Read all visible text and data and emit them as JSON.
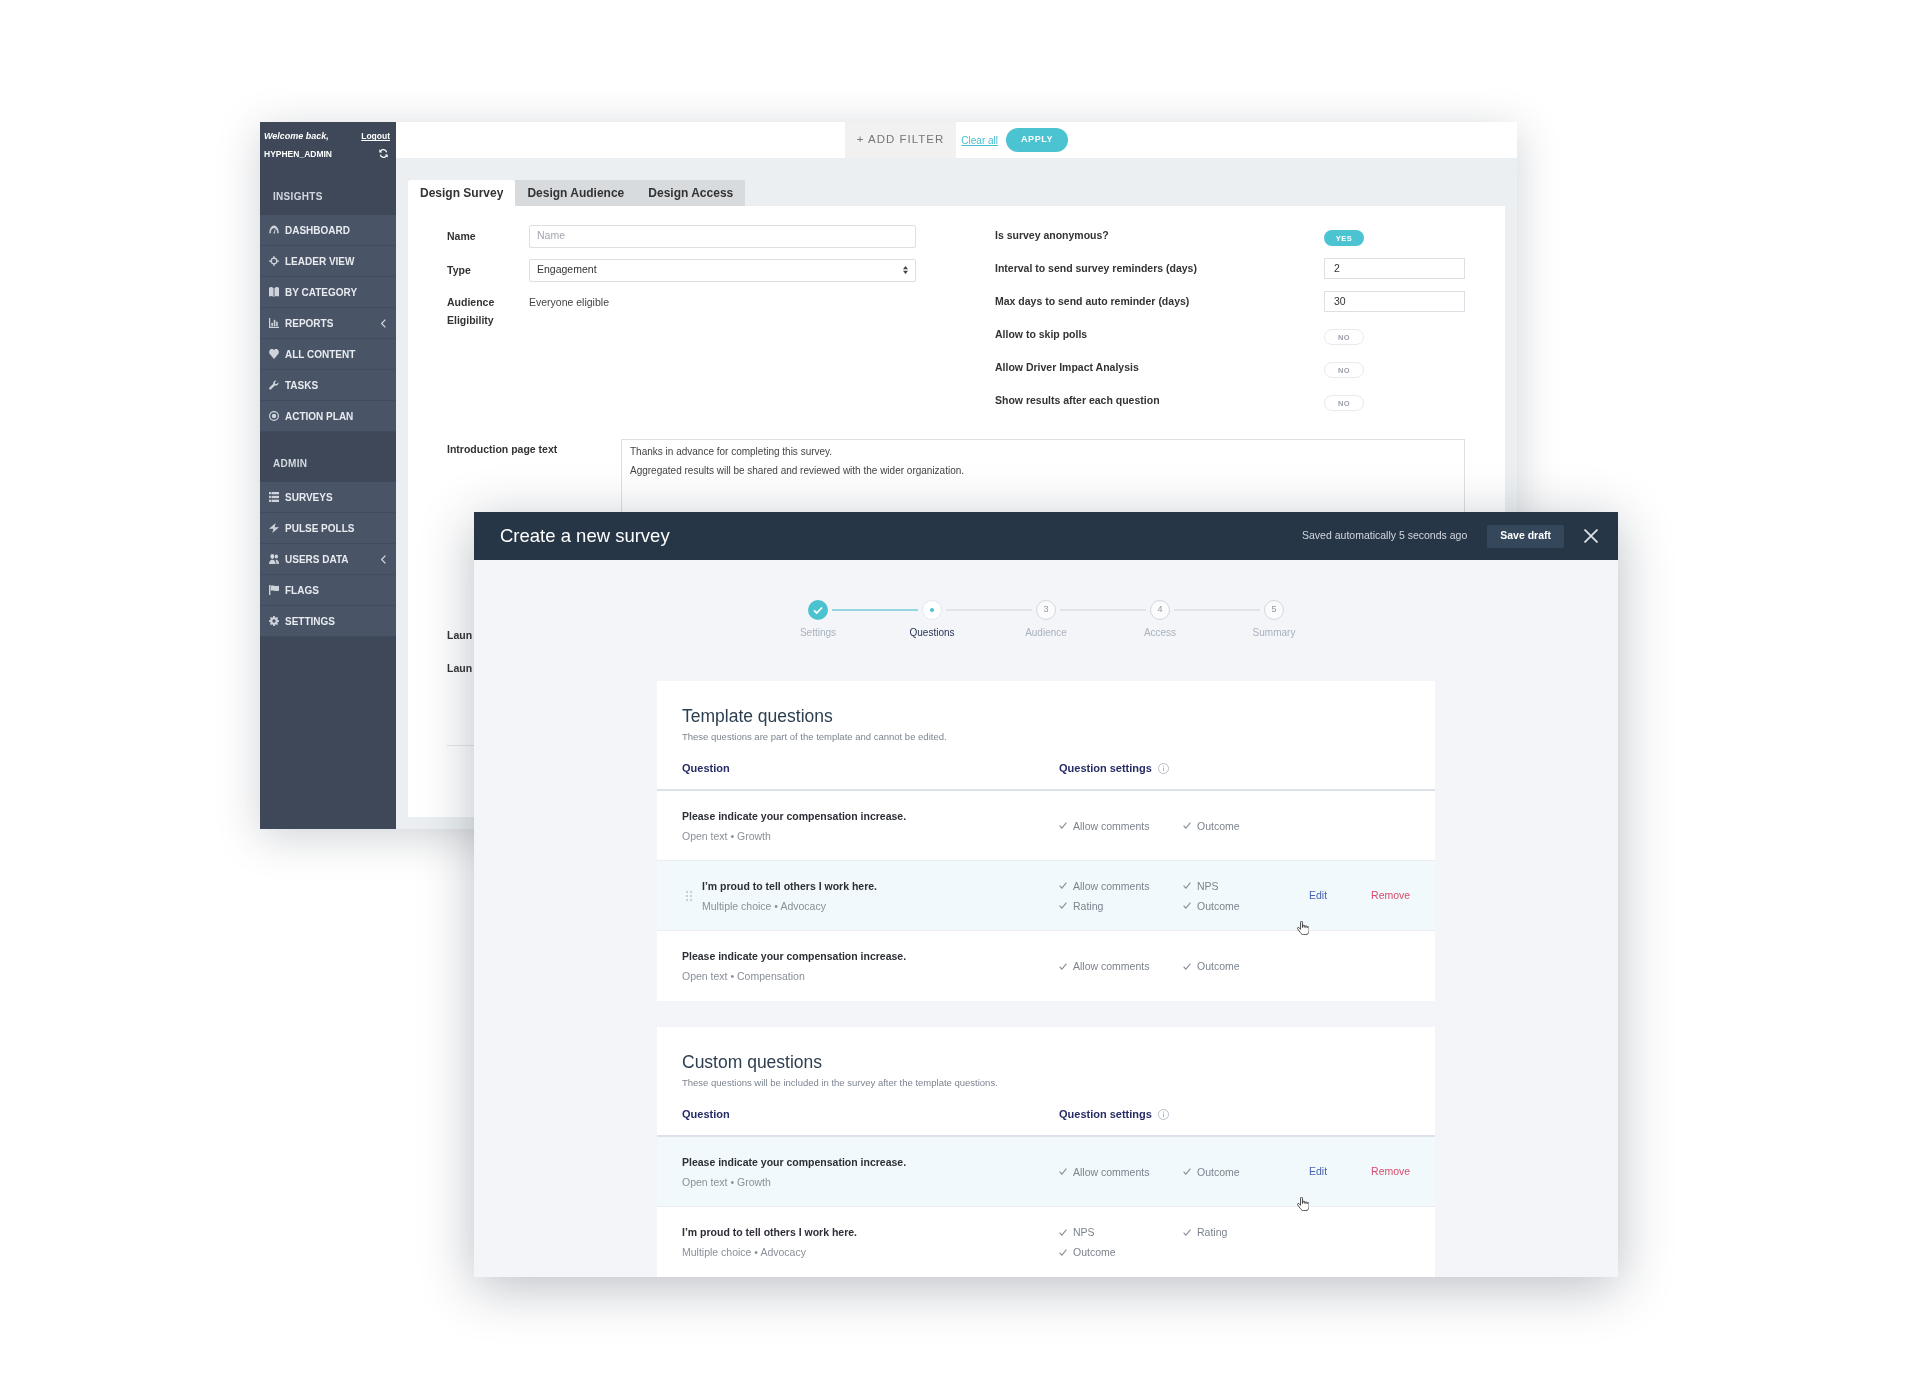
{
  "back_window": {
    "sidebar": {
      "greeting": "Welcome back,",
      "logout": "Logout",
      "username": "HYPHEN_ADMIN",
      "sections": [
        {
          "title": "INSIGHTS",
          "items": [
            {
              "label": "DASHBOARD",
              "submenu": false
            },
            {
              "label": "LEADER VIEW",
              "submenu": false
            },
            {
              "label": "BY CATEGORY",
              "submenu": false
            },
            {
              "label": "REPORTS",
              "submenu": true
            },
            {
              "label": "ALL CONTENT",
              "submenu": false
            },
            {
              "label": "TASKS",
              "submenu": false
            },
            {
              "label": "ACTION PLAN",
              "submenu": false
            }
          ]
        },
        {
          "title": "ADMIN",
          "items": [
            {
              "label": "SURVEYS",
              "submenu": false
            },
            {
              "label": "PULSE POLLS",
              "submenu": false
            },
            {
              "label": "USERS DATA",
              "submenu": true
            },
            {
              "label": "FLAGS",
              "submenu": false
            },
            {
              "label": "SETTINGS",
              "submenu": false
            }
          ]
        }
      ]
    },
    "filter_bar": {
      "add_filter": "+ ADD FILTER",
      "clear": "Clear all",
      "apply": "APPLY"
    },
    "tabs": [
      {
        "label": "Design Survey",
        "selected": true
      },
      {
        "label": "Design Audience",
        "selected": false
      },
      {
        "label": "Design Access",
        "selected": false
      }
    ],
    "fields": [
      {
        "kind": "input",
        "label": "Name",
        "placeholder": "Name"
      },
      {
        "kind": "select",
        "label": "Type",
        "value": "Engagement"
      },
      {
        "kind": "text",
        "label": "Audience Eligibility",
        "value": "Everyone eligible"
      }
    ],
    "settings": [
      {
        "kind": "toggle",
        "label": "Is survey anonymous?",
        "on": true,
        "value": "YES"
      },
      {
        "kind": "input",
        "label": "Interval to send survey reminders (days)",
        "value": "2"
      },
      {
        "kind": "input",
        "label": "Max days to send auto reminder (days)",
        "value": "30"
      },
      {
        "kind": "toggle",
        "label": "Allow to skip polls",
        "on": false,
        "value": "NO"
      },
      {
        "kind": "toggle",
        "label": "Allow Driver Impact Analysis",
        "on": false,
        "value": "NO"
      },
      {
        "kind": "toggle",
        "label": "Show results after each question",
        "on": false,
        "value": "NO"
      }
    ],
    "intro": {
      "label": "Introduction page text",
      "value": "Thanks in advance for completing this survey.\nAggregated results will be shared and reviewed with the wider organization."
    },
    "cut_labels": [
      "Laun",
      "Laun"
    ]
  },
  "modal": {
    "title": "Create a new survey",
    "save_status": "Saved automatically 5 seconds ago",
    "save_button": "Save draft",
    "steps": [
      {
        "label": "Settings",
        "done": true,
        "selected": false
      },
      {
        "label": "Questions",
        "done": false,
        "selected": true
      },
      {
        "label": "Audience",
        "done": false,
        "selected": false,
        "number": "3"
      },
      {
        "label": "Access",
        "done": false,
        "selected": false,
        "number": "4"
      },
      {
        "label": "Summary",
        "done": false,
        "selected": false,
        "number": "5"
      }
    ],
    "sections": [
      {
        "title": "Template questions",
        "subtitle": "These questions are part of the template and cannot be edited.",
        "columns": [
          {
            "label": "Question",
            "info": false
          },
          {
            "label": "Question settings",
            "info": true
          }
        ],
        "rows": [
          {
            "text": "Please indicate your compensation increase.",
            "meta": "Open text • Growth",
            "settings": [
              "Allow comments",
              "Outcome"
            ],
            "hovered": false,
            "drag_handle": false
          },
          {
            "text": "I’m proud to tell others I work here.",
            "meta": "Multiple choice • Advocacy",
            "settings": [
              "Allow comments",
              "NPS",
              "Rating",
              "Outcome"
            ],
            "hovered": true,
            "drag_handle": true,
            "actions": [
              {
                "kind": "edit",
                "label": "Edit"
              },
              {
                "kind": "remove",
                "label": "Remove"
              }
            ]
          },
          {
            "text": "Please indicate your compensation increase.",
            "meta": "Open text • Compensation",
            "settings": [
              "Allow comments",
              "Outcome"
            ],
            "hovered": false,
            "drag_handle": false
          }
        ]
      },
      {
        "title": "Custom questions",
        "subtitle": "These questions will be included in the survey after the template questions.",
        "columns": [
          {
            "label": "Question",
            "info": false
          },
          {
            "label": "Question settings",
            "info": true
          }
        ],
        "rows": [
          {
            "text": "Please indicate your compensation increase.",
            "meta": "Open text • Growth",
            "settings": [
              "Allow comments",
              "Outcome"
            ],
            "hovered": true,
            "drag_handle": false,
            "actions": [
              {
                "kind": "edit",
                "label": "Edit"
              },
              {
                "kind": "remove",
                "label": "Remove"
              }
            ]
          },
          {
            "text": "I’m proud to tell others I work here.",
            "meta": "Multiple choice • Advocacy",
            "settings": [
              "NPS",
              "Rating",
              "Outcome"
            ],
            "hovered": false,
            "drag_handle": false
          }
        ]
      }
    ]
  }
}
